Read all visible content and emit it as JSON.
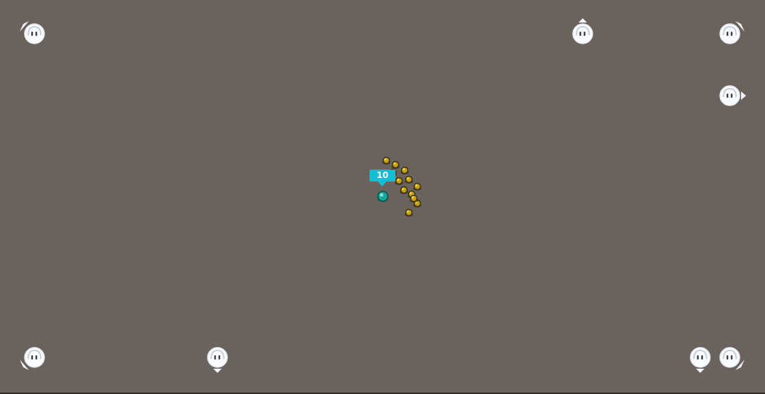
{
  "player": {
    "label": "10",
    "label_color": "#13bfd6",
    "body_color": "#16a89a"
  },
  "arena": {
    "floor_color": "#6a625c"
  },
  "offscreen_indicators": [
    {
      "id": "top-left",
      "icon": "bot-face-icon",
      "pointer": "up-left"
    },
    {
      "id": "top-center",
      "icon": "bot-face-icon",
      "pointer": "up"
    },
    {
      "id": "top-right",
      "icon": "bot-face-icon",
      "pointer": "up-right"
    },
    {
      "id": "right",
      "icon": "bot-face-icon",
      "pointer": "right"
    },
    {
      "id": "bottom-left",
      "icon": "bot-face-icon",
      "pointer": "down-left"
    },
    {
      "id": "bottom-center",
      "icon": "bot-face-icon",
      "pointer": "down"
    },
    {
      "id": "bottom-right-1",
      "icon": "bot-face-icon",
      "pointer": "down"
    },
    {
      "id": "bottom-right-2",
      "icon": "bot-face-icon",
      "pointer": "down-right"
    }
  ],
  "enemies": {
    "count": 12,
    "color": "#c8a20c"
  }
}
